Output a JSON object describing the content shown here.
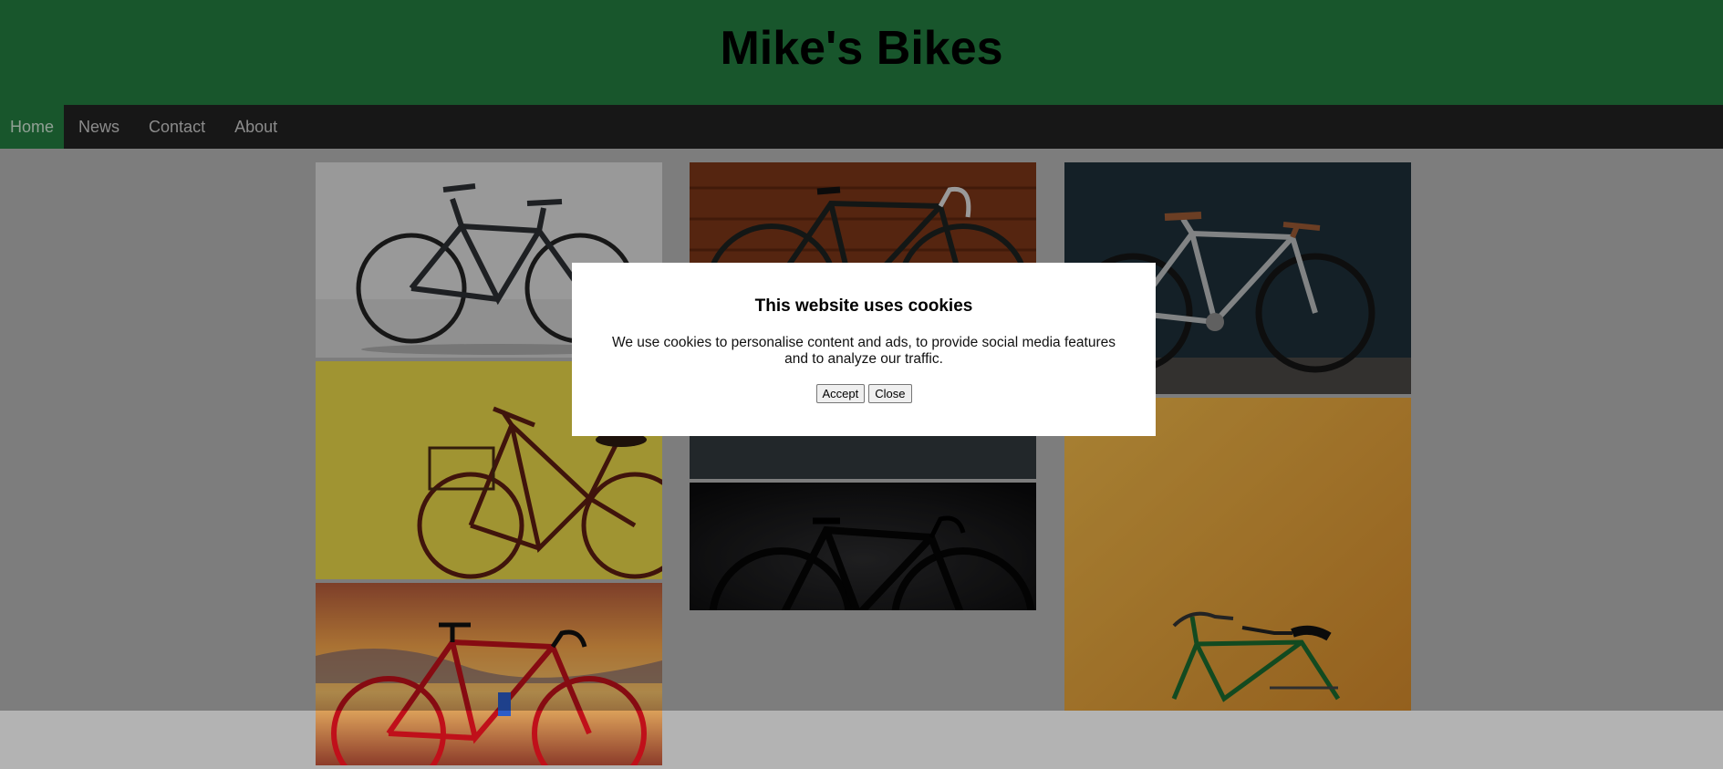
{
  "header": {
    "title": "Mike's Bikes"
  },
  "nav": {
    "items": [
      {
        "label": "Home",
        "active": true
      },
      {
        "label": "News",
        "active": false
      },
      {
        "label": "Contact",
        "active": false
      },
      {
        "label": "About",
        "active": false
      }
    ]
  },
  "gallery": {
    "photos": [
      {
        "subject": "black hybrid bike on grey wall"
      },
      {
        "subject": "yellow wall city bike with basket"
      },
      {
        "subject": "red road bike at sunset"
      },
      {
        "subject": "black road bike on wooden wall"
      },
      {
        "subject": "black fixie on concrete wall"
      },
      {
        "subject": "black road bike on dark background"
      },
      {
        "subject": "silver fixie on dark teal wall"
      },
      {
        "subject": "green vintage bike on orange wall"
      }
    ]
  },
  "cookie_modal": {
    "title": "This website uses cookies",
    "message": "We use cookies to personalise content and ads, to provide social media features and to analyze our traffic.",
    "accept_label": "Accept",
    "close_label": "Close"
  },
  "colors": {
    "header_bg": "#237c3f",
    "navbar_bg": "#222222",
    "page_bg": "#b3b3b3",
    "overlay": "rgba(0,0,0,0.3)"
  }
}
